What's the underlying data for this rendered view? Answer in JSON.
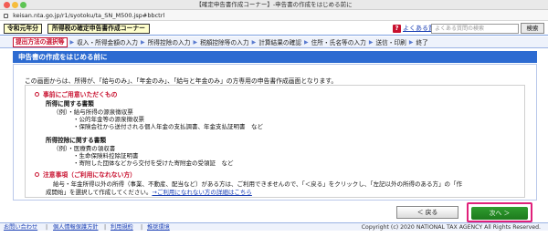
{
  "browser": {
    "window_title": "【確定申告書作成コーナー】-申告書の作成をはじめる前に",
    "url": "keisan.nta.go.jp/r1/syotoku/ta_SN_M500.jsp#bbctrl"
  },
  "header": {
    "era_badge": "令和元年分",
    "system_title": "所得税の確定申告書作成コーナー",
    "faq_label": "よくある質問",
    "faq_help": "?",
    "faq_search_placeholder": "よくある質問の検索",
    "search_button": "検索"
  },
  "steps": [
    "提出方法の選択等",
    "収入・所得金額の入力",
    "所得控除の入力",
    "税額控除等の入力",
    "計算結果の確認",
    "住所・氏名等の入力",
    "送信・印刷",
    "終了"
  ],
  "page_heading": "申告書の作成をはじめる前に",
  "intro": "この画面からは、所得が、「給与のみ」、「年金のみ」、「給与と年金のみ」の方専用の申告書作成画面となります。",
  "prep": {
    "title": "事前にご用意いただくもの",
    "income_docs_title": "所得に関する書類",
    "income_docs": [
      "（例）・給与所得の源泉徴収票",
      "・公的年金等の源泉徴収票",
      "・保険会社から送付される個人年金の支払調書、年金支払証明書　など"
    ],
    "deduction_docs_title": "所得控除に関する書類",
    "deduction_docs": [
      "（例）・医療費の領収書",
      "・生命保険料控除証明書",
      "・寄附した団体などから交付を受けた寄附金の受領証　など"
    ]
  },
  "notice": {
    "title": "注意事項（ご利用になれない方）",
    "line1": "給与・年金所得以外の所得（事業、不動産、配当など）がある方は、ご利用できませんので、「＜戻る」をクリックし、「左記以外の所得のある方」の「作",
    "line2": "成開始」を選択して作成してください。",
    "link": "→ご利用になれない方の詳細はこちら"
  },
  "buttons": {
    "back": "＜ 戻る",
    "next": "次へ ＞"
  },
  "footer": {
    "links": [
      "お問い合わせ",
      "個人情報保護方針",
      "利用規約",
      "推奨環境"
    ],
    "copyright": "Copyright (c) 2020 NATIONAL TAX AGENCY All Rights Reserved."
  }
}
